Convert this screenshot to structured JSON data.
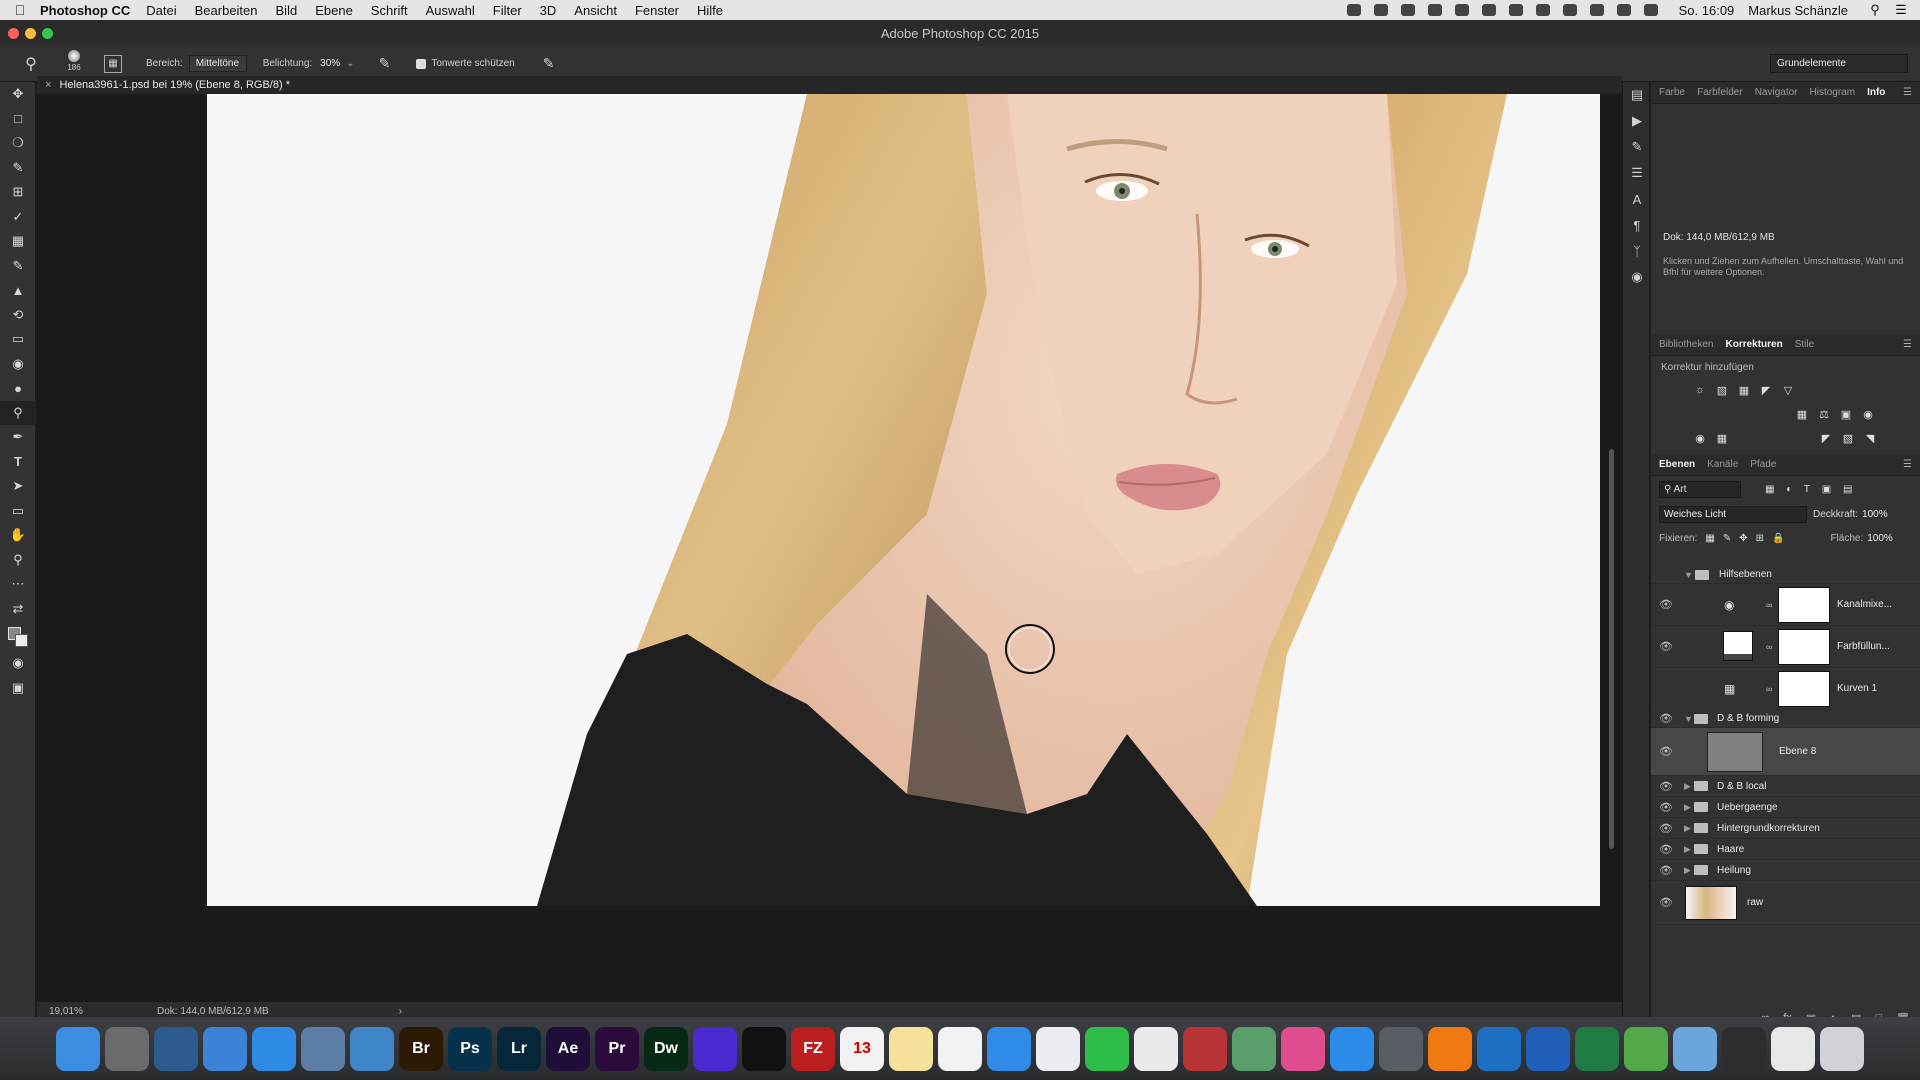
{
  "menubar": {
    "app_name": "Photoshop CC",
    "items": [
      "Datei",
      "Bearbeiten",
      "Bild",
      "Ebene",
      "Schrift",
      "Auswahl",
      "Filter",
      "3D",
      "Ansicht",
      "Fenster",
      "Hilfe"
    ],
    "clock": "So. 16:09",
    "user": "Markus Schänzle"
  },
  "window": {
    "title": "Adobe Photoshop CC 2015"
  },
  "options": {
    "brush_size": "186",
    "bereich_label": "Bereich:",
    "bereich_value": "Mitteltöne",
    "belichtung_label": "Belichtung:",
    "belichtung_value": "30%",
    "protect_label": "Tonwerte schützen",
    "workspace": "Grundelemente"
  },
  "document": {
    "tab_title": "Helena3961-1.psd bei 19% (Ebene 8, RGB/8) *",
    "zoom": "19,01%",
    "status": "Dok: 144,0 MB/612,9 MB"
  },
  "info_panel": {
    "tabs": [
      "Farbe",
      "Farbfelder",
      "Navigator",
      "Histogram",
      "Info"
    ],
    "doc": "Dok: 144,0 MB/612,9 MB",
    "hint": "Klicken und Ziehen zum Aufhellen. Umschalttaste, Wahl und Bfhl für weitere Optionen."
  },
  "adjust_panel": {
    "tabs": [
      "Bibliotheken",
      "Korrekturen",
      "Stile"
    ],
    "label": "Korrektur hinzufügen"
  },
  "layers_panel": {
    "tabs": [
      "Ebenen",
      "Kanäle",
      "Pfade"
    ],
    "filter": "Art",
    "blend_mode": "Weiches Licht",
    "opacity_label": "Deckkraft:",
    "opacity": "100%",
    "fix_label": "Fixieren:",
    "fill_label": "Fläche:",
    "fill": "100%",
    "layers": {
      "hilfsebenen": "Hilfsebenen",
      "kanalmixer": "Kanalmixe...",
      "farbfuellung": "Farbfüllun...",
      "kurven": "Kurven 1",
      "db_forming": "D & B forming",
      "ebene8": "Ebene 8",
      "db_local": "D & B local",
      "uebergaenge": "Uebergaenge",
      "hintergrund": "Hintergrundkorrekturen",
      "haare": "Haare",
      "heilung": "Heilung",
      "raw": "raw"
    }
  },
  "dock": {
    "apps": [
      "Finder",
      "Launchpad",
      "Mission",
      "Files",
      "Safari",
      "Preview",
      "1Password",
      "Br",
      "Ps",
      "Lr",
      "Ae",
      "Pr",
      "Dw",
      "Media",
      "Terminal",
      "FZ",
      "13",
      "Notes",
      "Reminders",
      "Messages",
      "Mail",
      "FaceTime",
      "Photos",
      "Photo Booth",
      "Image",
      "iTunes",
      "App Store",
      "System",
      "VLC",
      "Browser",
      "Word",
      "Excel",
      "Evernote",
      "Folder",
      "Brushes",
      "Lists",
      "Trash"
    ],
    "colors": [
      "#3a8de0",
      "#6b6b6b",
      "#2d5a8e",
      "#3c82d6",
      "#2d8be6",
      "#5b7da6",
      "#3f86c9",
      "#2b1a04",
      "#07304a",
      "#06263a",
      "#1f0e3a",
      "#2a0b3b",
      "#072a17",
      "#4a2ad0",
      "#111111",
      "#bb1e1e",
      "#f2f2f2",
      "#f5e19a",
      "#f2f2f2",
      "#2f8ae8",
      "#e9edf2",
      "#2fbd4a",
      "#eaeaea",
      "#b83333",
      "#5a9e6b",
      "#e04d8e",
      "#2b8be8",
      "#585c63",
      "#f07a12",
      "#1c6fc1",
      "#1f5fba",
      "#1f7a43",
      "#53a94a",
      "#6aa6dc",
      "#2d2d2d",
      "#e8e8e8",
      "#cfd2d6"
    ]
  }
}
